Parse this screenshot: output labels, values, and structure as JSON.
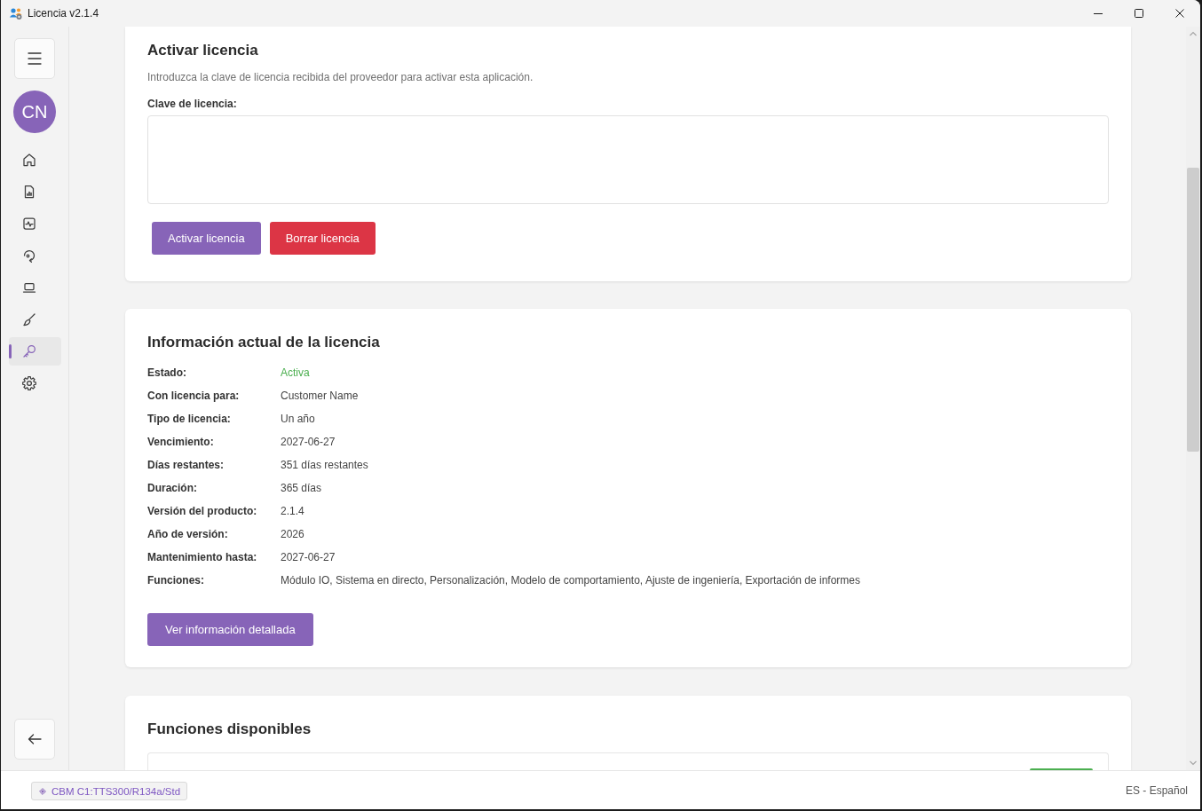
{
  "window": {
    "title": "Licencia v2.1.4"
  },
  "sidebar": {
    "avatar": "CN",
    "items": [
      {
        "kind": "home",
        "selected": false
      },
      {
        "kind": "report",
        "selected": false
      },
      {
        "kind": "activity",
        "selected": false
      },
      {
        "kind": "rotate",
        "selected": false
      },
      {
        "kind": "laptop",
        "selected": false
      },
      {
        "kind": "brush",
        "selected": false
      },
      {
        "kind": "key",
        "selected": true
      },
      {
        "kind": "gear",
        "selected": false
      }
    ]
  },
  "activation": {
    "title": "Activar licencia",
    "description": "Introduzca la clave de licencia recibida del proveedor para activar esta aplicación.",
    "key_label": "Clave de licencia:",
    "buttons": [
      {
        "label": "Activar licencia",
        "kind": "primary"
      },
      {
        "label": "Borrar licencia",
        "kind": "danger"
      }
    ]
  },
  "license_info": {
    "title": "Información actual de la licencia",
    "rows": [
      {
        "label": "Estado:",
        "value": "Activa",
        "color": "#4caf50"
      },
      {
        "label": "Con licencia para:",
        "value": "Customer Name"
      },
      {
        "label": "Tipo de licencia:",
        "value": "Un año"
      },
      {
        "label": "Vencimiento:",
        "value": "2027-06-27"
      },
      {
        "label": "Días restantes:",
        "value": "351 días restantes"
      },
      {
        "label": "Duración:",
        "value": "365 días"
      },
      {
        "label": "Versión del producto:",
        "value": "2.1.4"
      },
      {
        "label": "Año de versión:",
        "value": "2026"
      },
      {
        "label": "Mantenimiento hasta:",
        "value": "2027-06-27"
      },
      {
        "label": "Funciones:",
        "value": "Módulo IO, Sistema en directo, Personalización, Modelo de comportamiento, Ajuste de ingeniería, Exportación de informes"
      }
    ],
    "button": "Ver información detallada"
  },
  "features": {
    "title": "Funciones disponibles",
    "items": [
      {
        "badge": true
      }
    ]
  },
  "status_bar": {
    "profile": "CBM C1:TTS300/R134a/Std",
    "language": "ES - Español"
  }
}
